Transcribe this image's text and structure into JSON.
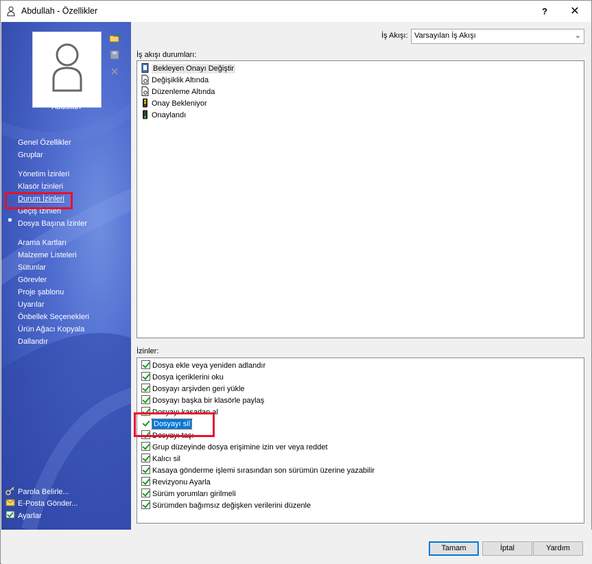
{
  "window": {
    "title": "Abdullah - Özellikler",
    "help": "?",
    "close": "✕"
  },
  "user": {
    "name": "Abdullah"
  },
  "nav": {
    "groups": [
      [
        "Genel Özellikler",
        "Gruplar"
      ],
      [
        "Yönetim İzinleri",
        "Klasör İzinleri",
        "Durum İzinleri",
        "Geçiş İzinleri",
        "Dosya Başına İzinler"
      ],
      [
        "Arama Kartları",
        "Malzeme Listeleri",
        "Sütunlar",
        "Görevler",
        "Proje şablonu",
        "Uyarılar",
        "Önbellek Seçenekleri",
        "Ürün Ağacı Kopyala",
        "Dallandır"
      ]
    ],
    "active": "Durum İzinleri",
    "bottom": [
      "Parola Belirle...",
      "E-Posta Gönder...",
      "Ayarlar"
    ]
  },
  "workflow": {
    "label": "İş Akışı:",
    "value": "Varsayılan İş Akışı",
    "states_label": "İş akışı durumları:",
    "states": [
      "Bekleyen Onayı Değiştir",
      "Değişiklik Altında",
      "Düzenleme Altında",
      "Onay Bekleniyor",
      "Onaylandı"
    ]
  },
  "permissions": {
    "label": "İzinler:",
    "items": [
      "Dosya ekle veya yeniden adlandır",
      "Dosya içeriklerini oku",
      "Dosyayı arşivden geri yükle",
      "Dosyayı başka bir klasörle paylaş",
      "Dosyayı kasadan al",
      "Dosyayı sil",
      "Dosyayı taşı",
      "Grup düzeyinde dosya erişimine izin ver veya reddet",
      "Kalıcı sil",
      "Kasaya gönderme işlemi sırasından son sürümün üzerine yazabilir",
      "Revizyonu Ayarla",
      "Sürüm yorumları girilmeli",
      "Sürümden bağımsız değişken verilerini düzenle"
    ],
    "selected": "Dosyayı sil"
  },
  "buttons": {
    "ok": "Tamam",
    "cancel": "İptal",
    "help": "Yardım"
  },
  "colors": {
    "highlight": "#e8102c",
    "selection": "#0078d7",
    "sidebar": "#4f6ccf"
  }
}
